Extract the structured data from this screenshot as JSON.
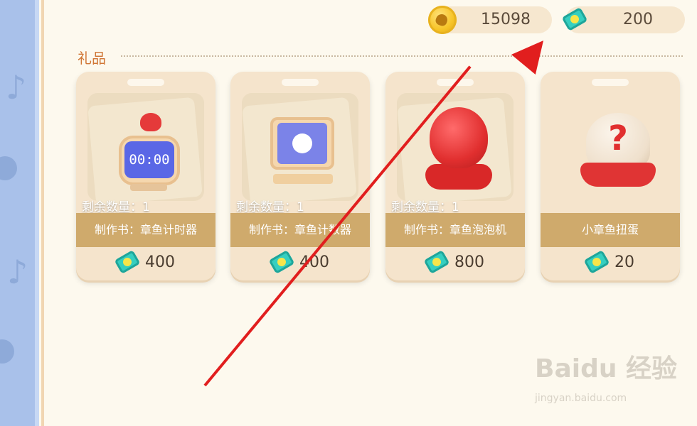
{
  "currency": {
    "coins": "15098",
    "tickets": "200",
    "coin_icon": "coin-icon",
    "ticket_icon": "ticket-icon"
  },
  "section": {
    "title": "礼品"
  },
  "items": [
    {
      "stock": "剩余数量：1",
      "name": "制作书：章鱼计时器",
      "price": "400",
      "art_icon": "octopus-timer-icon"
    },
    {
      "stock": "剩余数量：1",
      "name": "制作书：章鱼计数器",
      "price": "400",
      "art_icon": "octopus-counter-icon"
    },
    {
      "stock": "剩余数量：1",
      "name": "制作书：章鱼泡泡机",
      "price": "800",
      "art_icon": "octopus-bubble-machine-icon"
    },
    {
      "stock": "",
      "name": "小章鱼扭蛋",
      "price": "20",
      "art_icon": "mystery-capsule-icon"
    }
  ],
  "clock_display": "00:00",
  "watermark": {
    "brand": "Baidu 经验",
    "url": "jingyan.baidu.com"
  },
  "colors": {
    "accent_title": "#d07635",
    "name_bar": "#cfaa6c",
    "annotation_arrow": "#e11e1e",
    "ticket": "#35cfc0"
  }
}
